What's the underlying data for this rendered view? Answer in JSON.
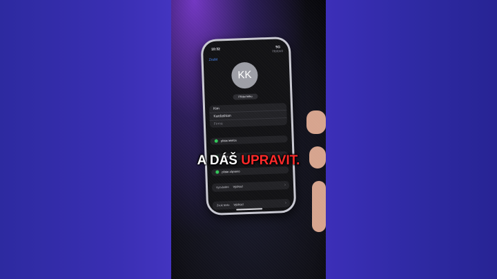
{
  "status_bar": {
    "time": "10:32",
    "network": "5G"
  },
  "nav": {
    "cancel": "Zrušit",
    "done": "Hotovo"
  },
  "avatar": {
    "initials": "KK"
  },
  "add_photo": "Přidat fotku",
  "name_fields": {
    "first": "Kim",
    "last": "Kardashian",
    "company": "Firma"
  },
  "add_phone": "přidat telefon",
  "add_email": "přidat e-mail",
  "add_pronunciation": "přidat zájmeno",
  "ringtone": {
    "label": "Vyzvánění",
    "value": "Výchozí"
  },
  "text_tone": {
    "label": "Zvuk textu",
    "value": "Výchozí"
  },
  "caption": {
    "part1": "A DÁŠ",
    "part2": "UPRAVIT."
  },
  "colors": {
    "background": "#2a2390",
    "accent_link": "#4c8dff",
    "add_green": "#32c759",
    "caption_red": "#ff2a2a"
  }
}
